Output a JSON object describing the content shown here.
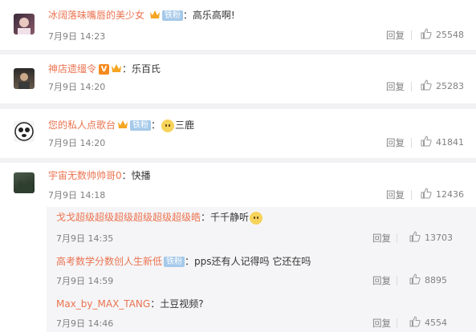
{
  "comments": [
    {
      "username": "冰阔落味嘴唇的美少女",
      "fan_label": "铁粉",
      "text": "高乐高啊!",
      "time": "7月9日 14:23",
      "reply": "回复",
      "likes": "25548"
    },
    {
      "username": "神店遗缰令",
      "vip_label": "V",
      "text": "乐百氏",
      "time": "7月9日 14:20",
      "reply": "回复",
      "likes": "25283"
    },
    {
      "username": "您的私人点歌台",
      "fan_label": "铁粉",
      "text": "三鹿",
      "time": "7月9日 14:20",
      "reply": "回复",
      "likes": "41841"
    },
    {
      "username": "宇宙无数帅帅哥0",
      "text": "快播",
      "time": "7月9日 14:18",
      "reply": "回复",
      "likes": "12436"
    }
  ],
  "replies": [
    {
      "username": "戈戈超级超级超级超级超级超级皓",
      "text": "千千静听",
      "time": "7月9日 14:35",
      "reply": "回复",
      "likes": "13703"
    },
    {
      "username": "高考数学分数创人生新低",
      "fan_label": "铁粉",
      "text": "pps还有人记得吗 它还在吗",
      "time": "7月9日 14:59",
      "reply": "回复",
      "likes": "8895"
    },
    {
      "username": "Max_by_MAX_TANG",
      "text": "土豆视频?",
      "time": "7月9日 14:46",
      "reply": "回复",
      "likes": "4554"
    }
  ],
  "colors": {
    "username": "#eb7350",
    "meta": "#808080",
    "background": "#f2f2f5"
  },
  "icons": {
    "like": "thumbs-up-icon",
    "badge": "crown-badge-icon",
    "emoji": "doge-emoji-icon"
  }
}
